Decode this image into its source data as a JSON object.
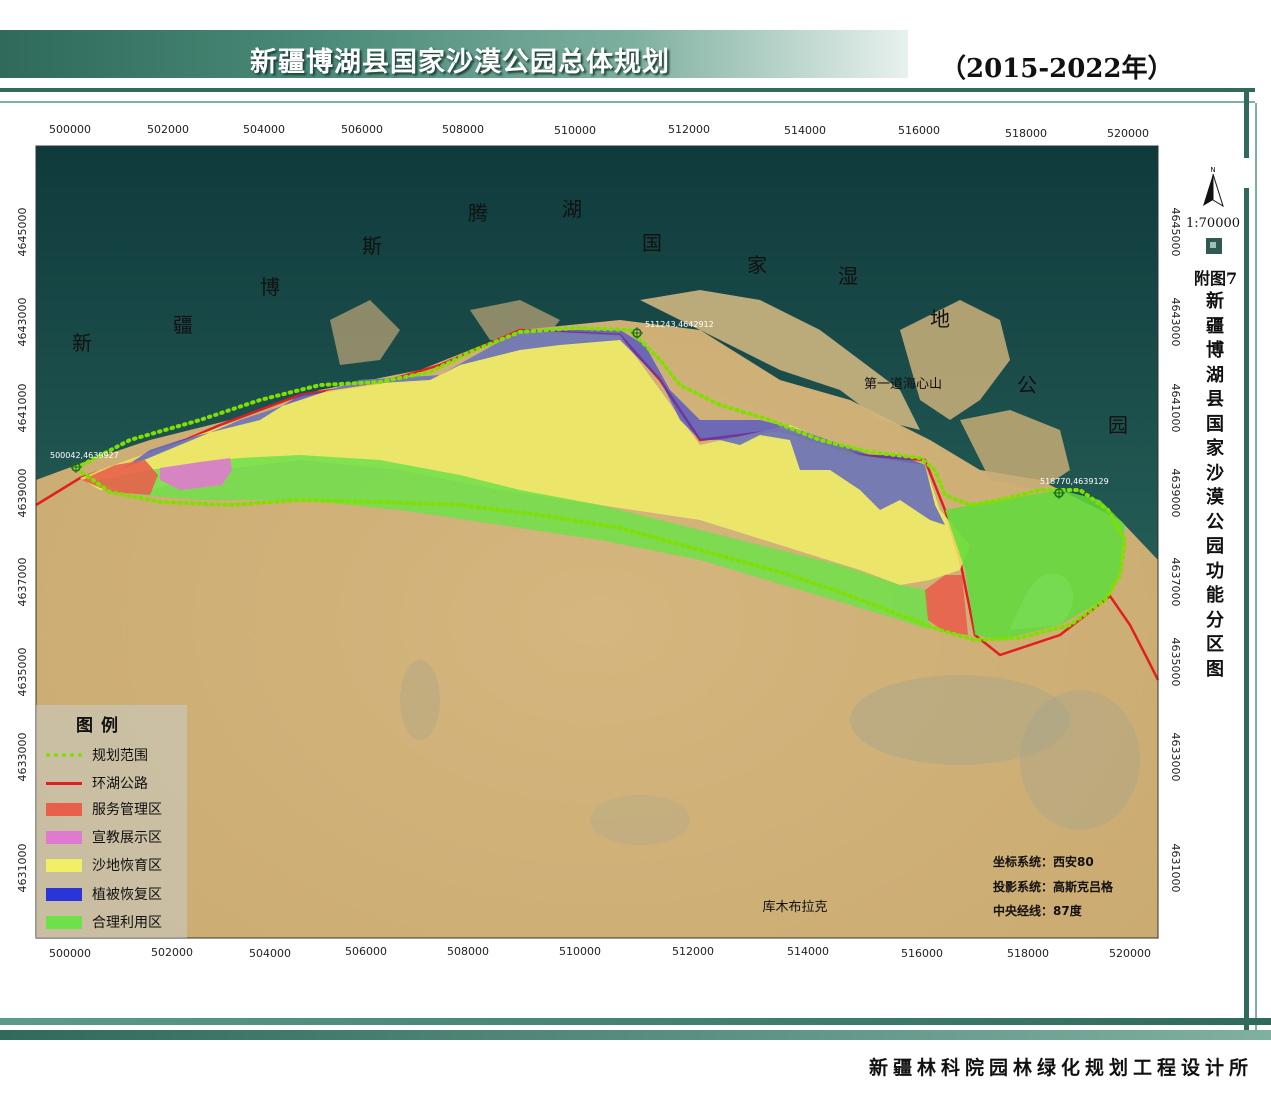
{
  "header": {
    "title": "新疆博湖县国家沙漠公园总体规划",
    "period": "（2015-2022年）"
  },
  "footer": {
    "org": "新疆林科院园林绿化规划工程设计所"
  },
  "sidebar": {
    "figure": "附图7",
    "scale": "1:70000",
    "vertical_title": "新疆博湖县国家沙漠公园功能分区图"
  },
  "grid": {
    "top_ticks": [
      "500000",
      "502000",
      "504000",
      "506000",
      "508000",
      "510000",
      "512000",
      "514000",
      "516000",
      "518000",
      "520000"
    ],
    "bottom_ticks": [
      "500000",
      "502000",
      "504000",
      "506000",
      "508000",
      "510000",
      "512000",
      "514000",
      "516000",
      "518000",
      "520000"
    ],
    "left_ticks": [
      "4645000",
      "4643000",
      "4641000",
      "4639000",
      "4637000",
      "4635000",
      "4633000",
      "4631000"
    ],
    "right_ticks": [
      "4645000",
      "4643000",
      "4641000",
      "4639000",
      "4637000",
      "4635000",
      "4633000",
      "4631000"
    ]
  },
  "map_labels": {
    "lake_chars": [
      "新",
      "疆",
      "博",
      "斯",
      "腾",
      "湖",
      "国",
      "家",
      "湿",
      "地",
      "公",
      "园"
    ],
    "hill": "第一道海心山",
    "desert": "库木布拉克"
  },
  "points": [
    {
      "label": "500042,4639927"
    },
    {
      "label": "511243,4642912"
    },
    {
      "label": "518770,4639129"
    }
  ],
  "legend": {
    "title": "图例",
    "items": [
      {
        "label": "规划范围",
        "kind": "dots",
        "color": "#7fe000"
      },
      {
        "label": "环湖公路",
        "kind": "line",
        "color": "#e02020"
      },
      {
        "label": "服务管理区",
        "kind": "fill",
        "color": "#e8604c"
      },
      {
        "label": "宣教展示区",
        "kind": "fill",
        "color": "#e07ad0"
      },
      {
        "label": "沙地恢育区",
        "kind": "fill",
        "color": "#f0ef66"
      },
      {
        "label": "植被恢复区",
        "kind": "fill",
        "color": "#2a35d8"
      },
      {
        "label": "合理利用区",
        "kind": "fill",
        "color": "#6ee04a"
      }
    ]
  },
  "info": {
    "coord_system": "坐标系统：西安80",
    "projection": "投影系统：高斯克吕格",
    "meridian": "中央经线：87度"
  }
}
